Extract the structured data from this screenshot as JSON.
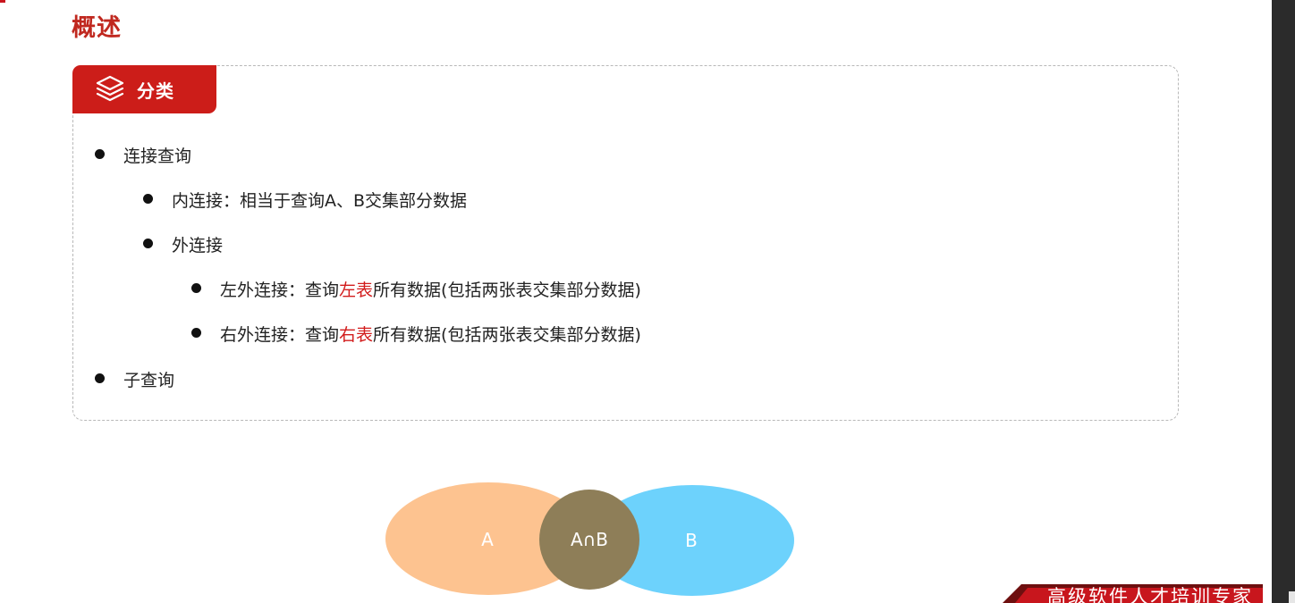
{
  "page_title": "概述",
  "card": {
    "tag_label": "分类",
    "tag_icon": "layers-icon",
    "items": {
      "join_query": "连接查询",
      "inner_join": "内连接：相当于查询A、B交集部分数据",
      "outer_join": "外连接",
      "left_outer": {
        "prefix": "左外连接：查询",
        "highlight": "左表",
        "suffix": "所有数据(包括两张表交集部分数据)"
      },
      "right_outer": {
        "prefix": "右外连接：查询",
        "highlight": "右表",
        "suffix": "所有数据(包括两张表交集部分数据)"
      },
      "subquery": "子查询"
    }
  },
  "venn": {
    "label_a": "A",
    "label_b": "B",
    "label_intersection": "A∩B",
    "color_a": "#fdc390",
    "color_b": "#6dd2fc",
    "color_intersection": "#8e7e58"
  },
  "footer": {
    "text": "高级软件人才培训专家"
  },
  "colors": {
    "accent": "#cc1d19",
    "title": "#c0281f",
    "highlight": "#d21c1c"
  }
}
